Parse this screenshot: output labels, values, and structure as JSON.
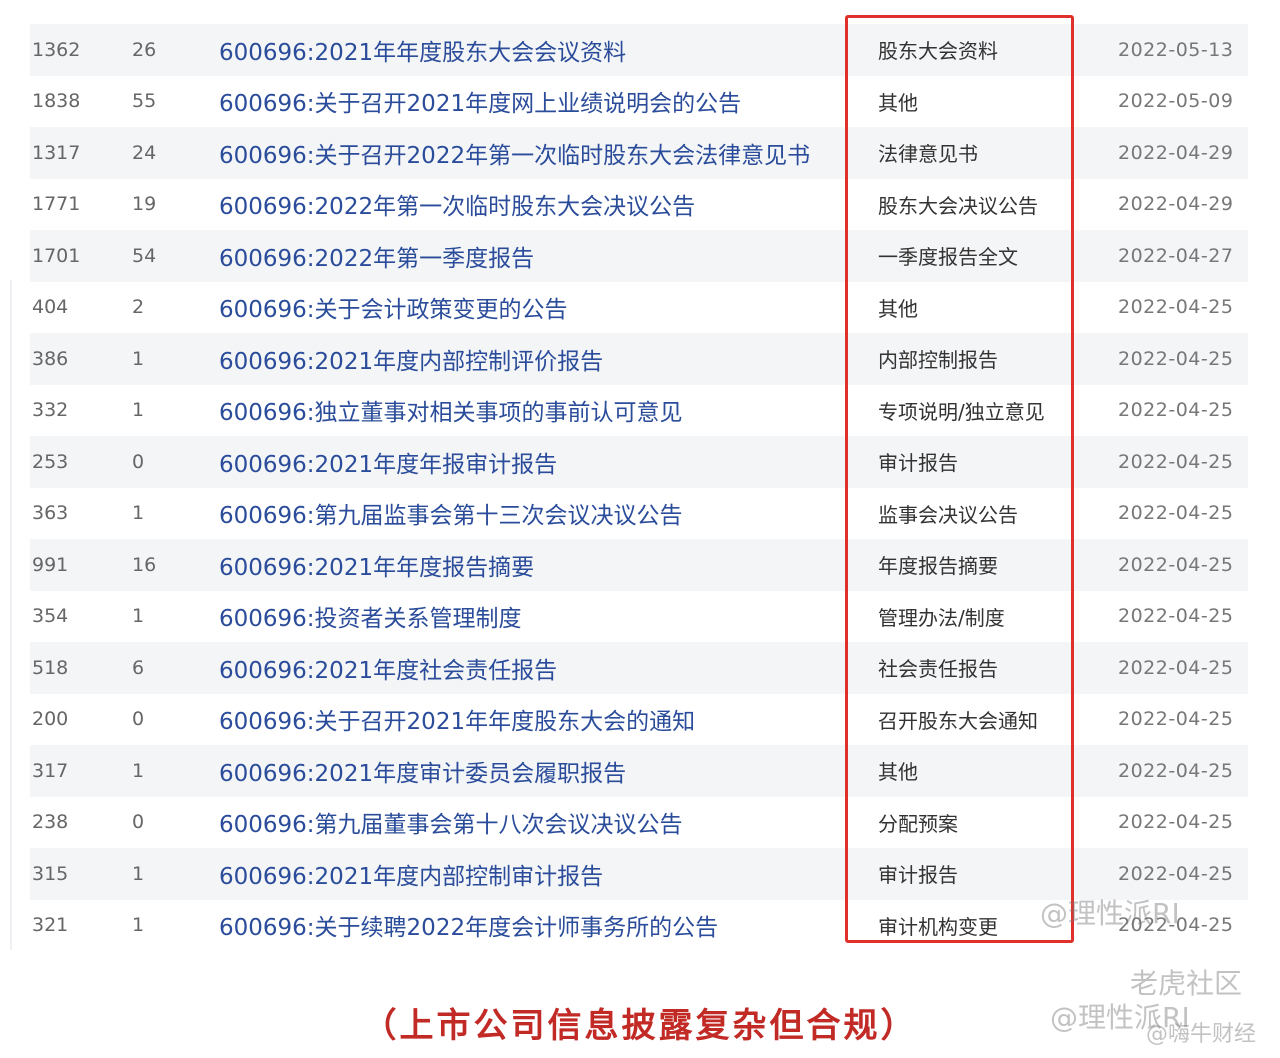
{
  "rows": [
    {
      "views": "1362",
      "count": "26",
      "title": "600696:2021年年度股东大会会议资料",
      "type": "股东大会资料",
      "date": "2022-05-13"
    },
    {
      "views": "1838",
      "count": "55",
      "title": "600696:关于召开2021年度网上业绩说明会的公告",
      "type": "其他",
      "date": "2022-05-09"
    },
    {
      "views": "1317",
      "count": "24",
      "title": "600696:关于召开2022年第一次临时股东大会法律意见书",
      "type": "法律意见书",
      "date": "2022-04-29"
    },
    {
      "views": "1771",
      "count": "19",
      "title": "600696:2022年第一次临时股东大会决议公告",
      "type": "股东大会决议公告",
      "date": "2022-04-29"
    },
    {
      "views": "1701",
      "count": "54",
      "title": "600696:2022年第一季度报告",
      "type": "一季度报告全文",
      "date": "2022-04-27"
    },
    {
      "views": "404",
      "count": "2",
      "title": "600696:关于会计政策变更的公告",
      "type": "其他",
      "date": "2022-04-25"
    },
    {
      "views": "386",
      "count": "1",
      "title": "600696:2021年度内部控制评价报告",
      "type": "内部控制报告",
      "date": "2022-04-25"
    },
    {
      "views": "332",
      "count": "1",
      "title": "600696:独立董事对相关事项的事前认可意见",
      "type": "专项说明/独立意见",
      "date": "2022-04-25"
    },
    {
      "views": "253",
      "count": "0",
      "title": "600696:2021年度年报审计报告",
      "type": "审计报告",
      "date": "2022-04-25"
    },
    {
      "views": "363",
      "count": "1",
      "title": "600696:第九届监事会第十三次会议决议公告",
      "type": "监事会决议公告",
      "date": "2022-04-25"
    },
    {
      "views": "991",
      "count": "16",
      "title": "600696:2021年年度报告摘要",
      "type": "年度报告摘要",
      "date": "2022-04-25"
    },
    {
      "views": "354",
      "count": "1",
      "title": "600696:投资者关系管理制度",
      "type": "管理办法/制度",
      "date": "2022-04-25"
    },
    {
      "views": "518",
      "count": "6",
      "title": "600696:2021年度社会责任报告",
      "type": "社会责任报告",
      "date": "2022-04-25"
    },
    {
      "views": "200",
      "count": "0",
      "title": "600696:关于召开2021年年度股东大会的通知",
      "type": "召开股东大会通知",
      "date": "2022-04-25"
    },
    {
      "views": "317",
      "count": "1",
      "title": "600696:2021年度审计委员会履职报告",
      "type": "其他",
      "date": "2022-04-25"
    },
    {
      "views": "238",
      "count": "0",
      "title": "600696:第九届董事会第十八次会议决议公告",
      "type": "分配预案",
      "date": "2022-04-25"
    },
    {
      "views": "315",
      "count": "1",
      "title": "600696:2021年度内部控制审计报告",
      "type": "审计报告",
      "date": "2022-04-25"
    },
    {
      "views": "321",
      "count": "1",
      "title": "600696:关于续聘2022年度会计师事务所的公告",
      "type": "审计机构变更",
      "date": "2022-04-25"
    }
  ],
  "caption": "（上市公司信息披露复杂但合规）",
  "watermarks": {
    "wm1": "@理性派RI",
    "wm2": "老虎社区",
    "wm3": "@理性派RI",
    "wm4": "@嗨牛财经"
  },
  "colors": {
    "link": "#2a4c9a",
    "highlight": "#e0302c",
    "caption": "#c22a26",
    "stripe": "#f4f5f7"
  }
}
